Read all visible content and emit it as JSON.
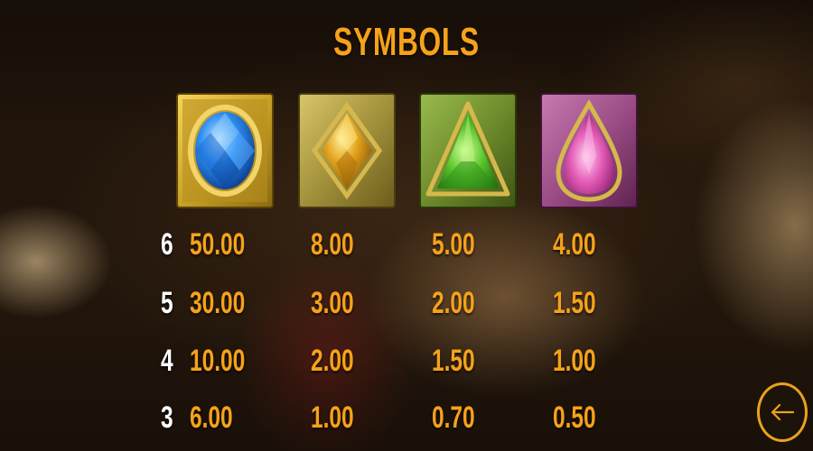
{
  "title": "SYMBOLS",
  "symbols": [
    {
      "icon": "blue-gem-icon",
      "frame_color": "#c9a227",
      "gem_color": "#2d8ef0",
      "pays": [
        "50.00",
        "30.00",
        "10.00",
        "6.00"
      ]
    },
    {
      "icon": "yellow-gem-icon",
      "frame_color": "#a3923c",
      "gem_color": "#e3a41c",
      "pays": [
        "8.00",
        "3.00",
        "2.00",
        "1.00"
      ]
    },
    {
      "icon": "green-gem-icon",
      "frame_color": "#6e8c2c",
      "gem_color": "#59c62c",
      "pays": [
        "5.00",
        "2.00",
        "1.50",
        "0.70"
      ]
    },
    {
      "icon": "pink-gem-icon",
      "frame_color": "#9c4d86",
      "gem_color": "#e35bb6",
      "pays": [
        "4.00",
        "1.50",
        "1.00",
        "0.50"
      ]
    }
  ],
  "rows": [
    "6",
    "5",
    "4",
    "3"
  ],
  "back_button": {
    "icon": "back-arrow-icon"
  },
  "colors": {
    "accent": "#f6a21a",
    "row_label": "#ffffff"
  }
}
